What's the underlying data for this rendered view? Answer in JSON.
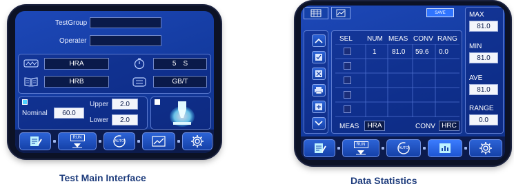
{
  "left_screen": {
    "test_group_label": "TestGroup",
    "test_group_value": "",
    "operator_label": "Operater",
    "operator_value": "",
    "scale_primary": "HRA",
    "scale_secondary": "HRB",
    "dwell_value": "5",
    "dwell_unit": "S",
    "standard": "GB/T",
    "nominal_label": "Nominal",
    "nominal_value": "60.0",
    "upper_label": "Upper",
    "upper_value": "2.0",
    "lower_label": "Lower",
    "lower_value": "2.0",
    "run_label": "RUN",
    "auto_label": "AUTO"
  },
  "right_screen": {
    "save_label": "SAVE",
    "columns": [
      "SEL",
      "NUM",
      "MEAS",
      "CONV",
      "RANG"
    ],
    "rows": [
      {
        "num": "1",
        "meas": "81.0",
        "conv": "59.6",
        "rang": "0.0"
      },
      {
        "num": "",
        "meas": "",
        "conv": "",
        "rang": ""
      },
      {
        "num": "",
        "meas": "",
        "conv": "",
        "rang": ""
      },
      {
        "num": "",
        "meas": "",
        "conv": "",
        "rang": ""
      },
      {
        "num": "",
        "meas": "",
        "conv": "",
        "rang": ""
      }
    ],
    "meas_label": "MEAS",
    "meas_scale": "HRA",
    "conv_label": "CONV",
    "conv_scale": "HRC",
    "max_label": "MAX",
    "max_value": "81.0",
    "min_label": "MIN",
    "min_value": "81.0",
    "ave_label": "AVE",
    "ave_value": "81.0",
    "range_label": "RANGE",
    "range_value": "0.0",
    "run_label": "RUN",
    "auto_label": "AUTO"
  },
  "captions": {
    "left": "Test Main Interface",
    "right": "Data Statistics"
  },
  "colors": {
    "screen_blue": "#1d48b8",
    "field_dark": "#0a1a4a",
    "accent_cyan": "#4fd3ff",
    "caption": "#1e3c7c"
  }
}
